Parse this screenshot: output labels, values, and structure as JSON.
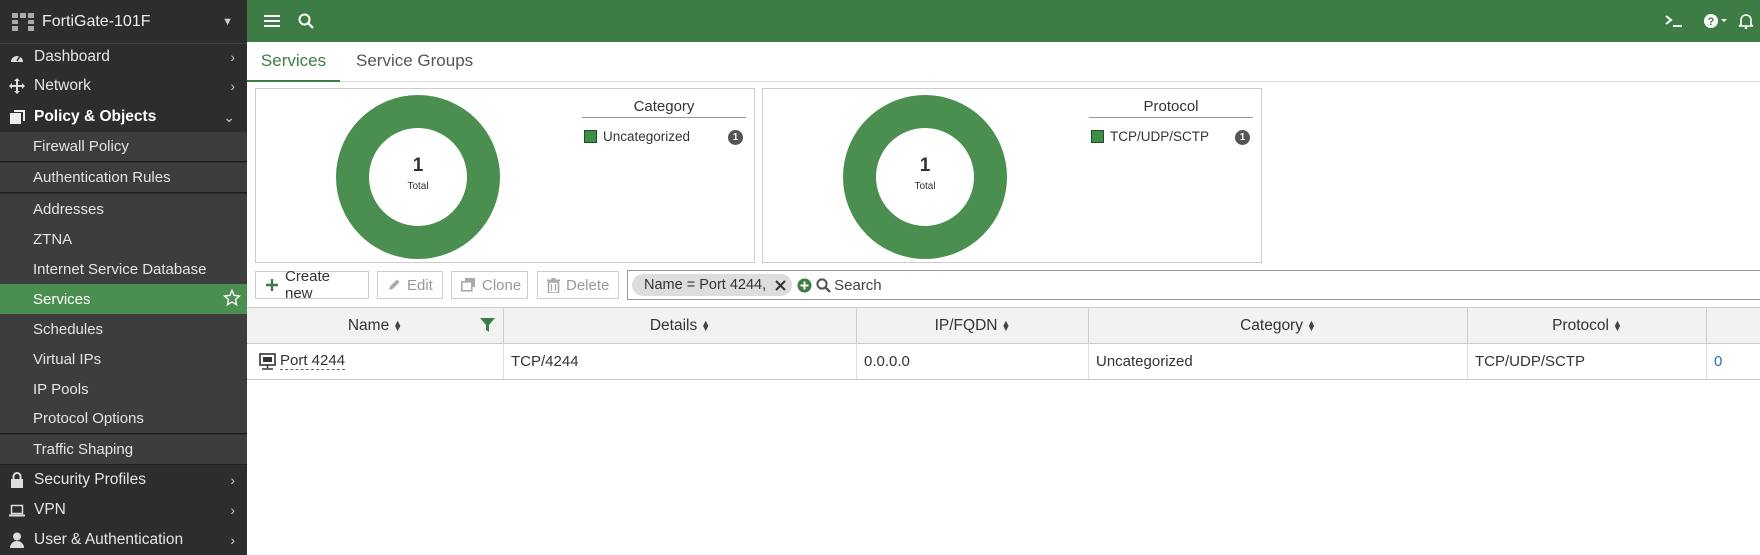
{
  "device": {
    "name": "FortiGate-101F"
  },
  "nav": {
    "dashboard": "Dashboard",
    "network": "Network",
    "policy_objects": "Policy & Objects",
    "sub": [
      "Firewall Policy",
      "Authentication Rules",
      "Addresses",
      "ZTNA",
      "Internet Service Database",
      "Services",
      "Schedules",
      "Virtual IPs",
      "IP Pools",
      "Protocol Options",
      "Traffic Shaping"
    ],
    "security_profiles": "Security Profiles",
    "vpn": "VPN",
    "user_auth": "User & Authentication"
  },
  "tabs": [
    "Services",
    "Service Groups"
  ],
  "charts": [
    {
      "total": "1",
      "total_label": "Total",
      "legend_title": "Category",
      "legend_item": "Uncategorized",
      "count": "1",
      "color": "#4a8f50"
    },
    {
      "total": "1",
      "total_label": "Total",
      "legend_title": "Protocol",
      "legend_item": "TCP/UDP/SCTP",
      "count": "1",
      "color": "#4a8f50"
    }
  ],
  "toolbar": {
    "create": "Create new",
    "edit": "Edit",
    "clone": "Clone",
    "delete": "Delete"
  },
  "search": {
    "filter_chip": "Name = Port 4244,",
    "placeholder": "Search"
  },
  "table": {
    "headers": [
      "Name",
      "Details",
      "IP/FQDN",
      "Category",
      "Protocol"
    ],
    "rows": [
      {
        "name": "Port 4244",
        "details": "TCP/4244",
        "ip": "0.0.0.0",
        "category": "Uncategorized",
        "protocol": "TCP/UDP/SCTP",
        "ref": "0"
      }
    ]
  },
  "colors": {
    "accent": "#3d7d45",
    "sidebar": "#2d2d2d",
    "active_nav": "#4a8f50"
  }
}
